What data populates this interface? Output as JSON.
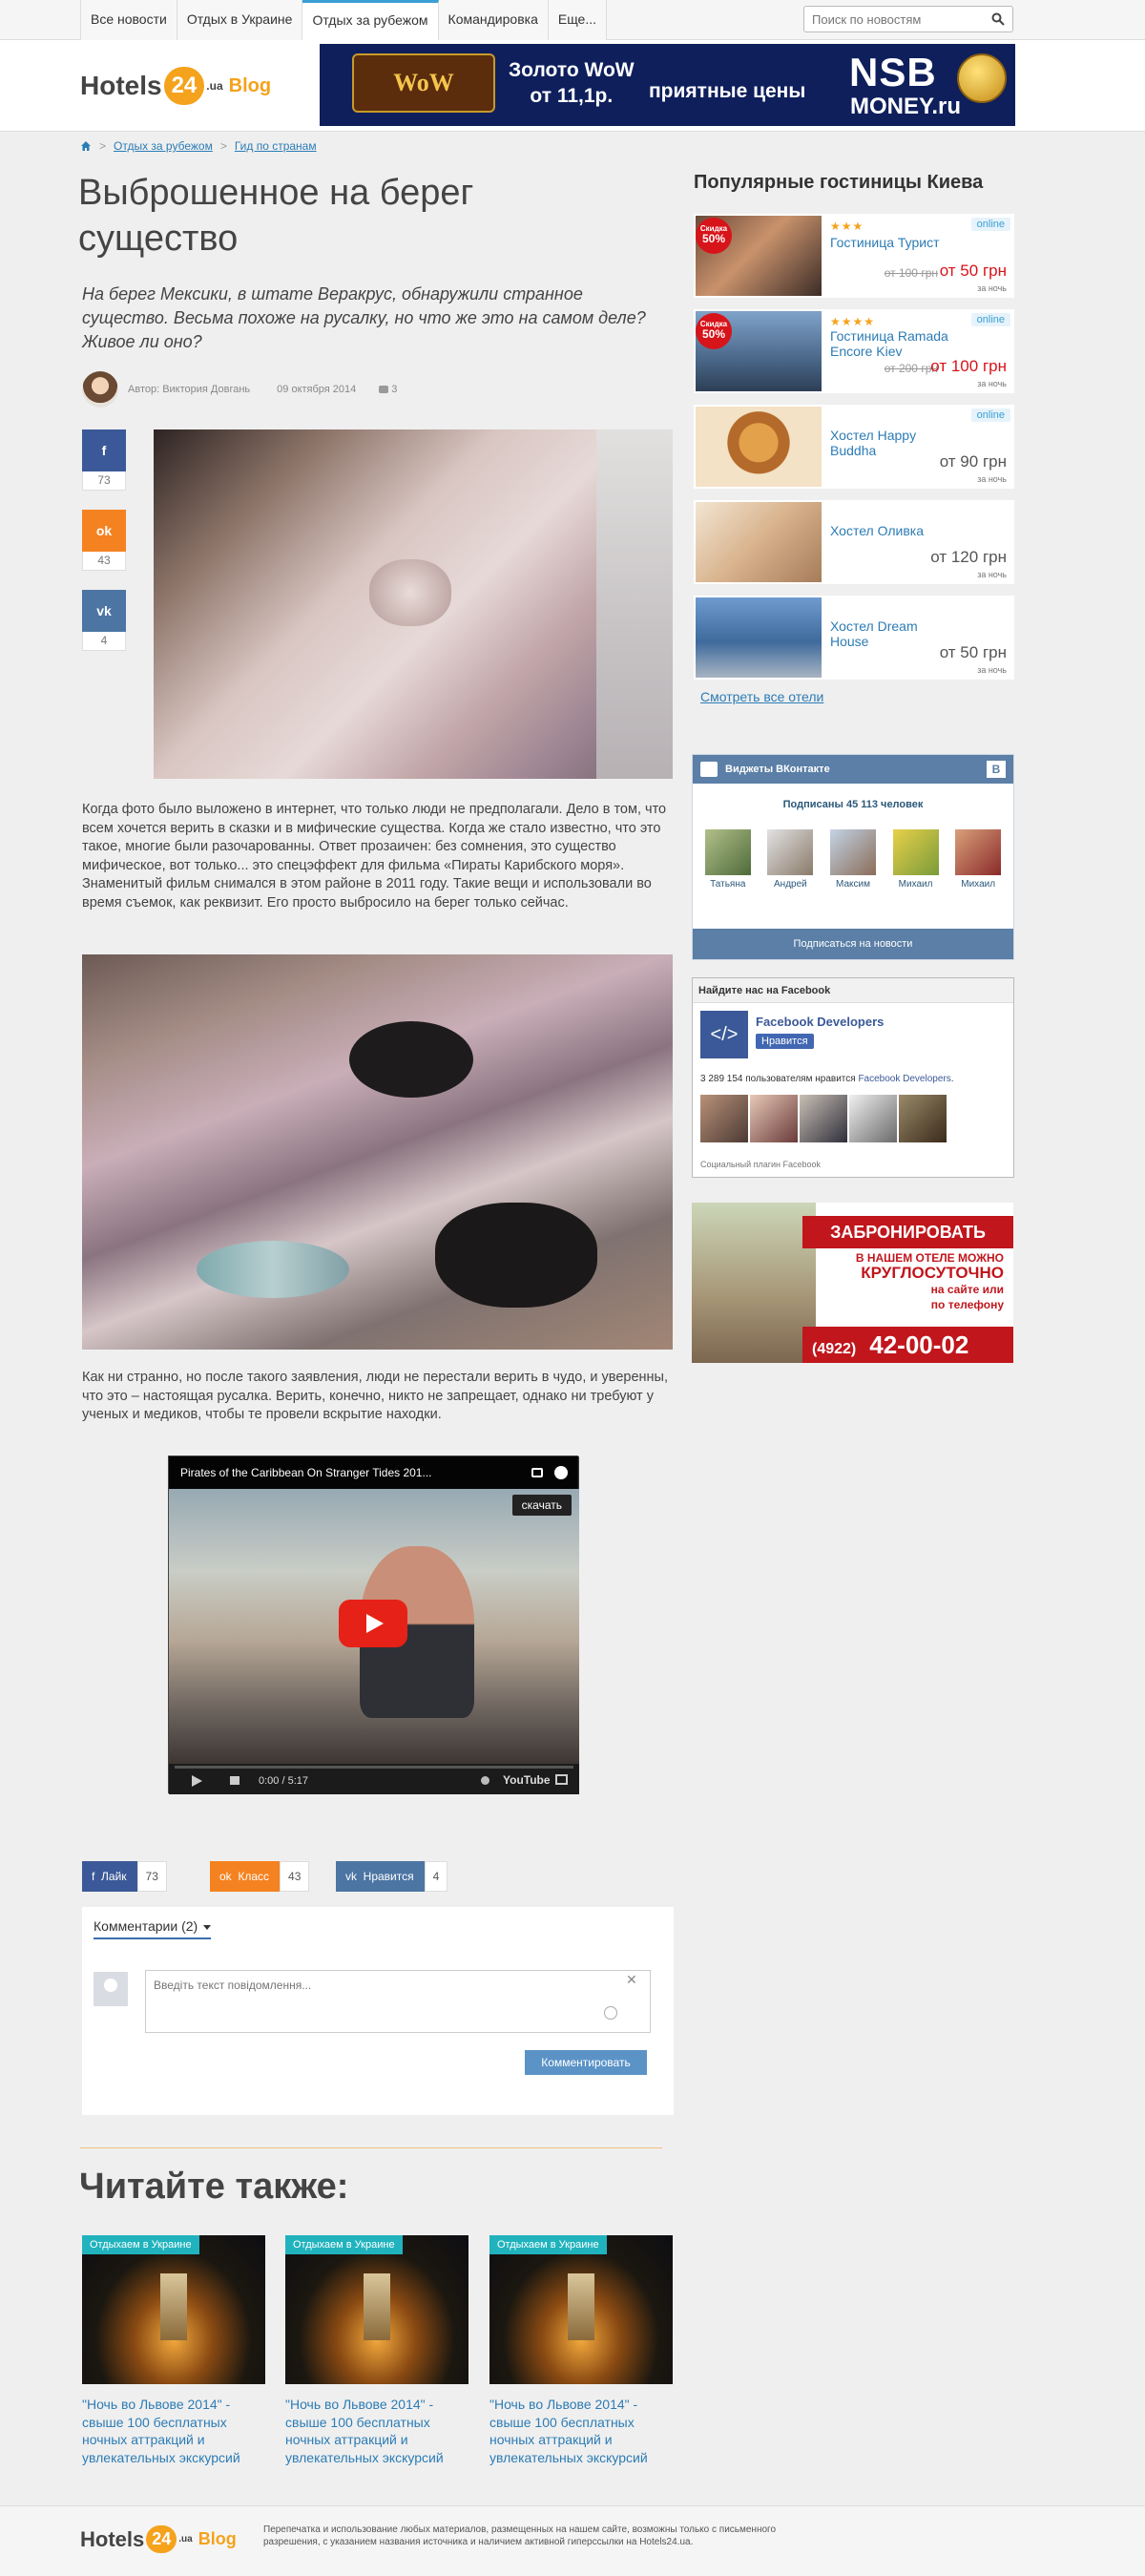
{
  "nav": {
    "items": [
      "Все новости",
      "Отдых в Украине",
      "Отдых за рубежом",
      "Командировка",
      "Еще..."
    ],
    "active_index": 2,
    "search_placeholder": "Поиск по новостям"
  },
  "logo": {
    "part1": "Hotels",
    "part2": "24",
    "part3": ".ua",
    "part4": "Blog"
  },
  "top_banner": {
    "game_logo": "WORLD WARCRAFT",
    "gold_line1": "Золото WoW",
    "gold_line2": "от 11,1р.",
    "prices": "приятные цены",
    "brand1": "NSB",
    "brand2": "MONEY.ru"
  },
  "breadcrumb": {
    "item1": "Отдых за рубежом",
    "item2": "Гид по странам"
  },
  "article": {
    "title": "Выброшенное на берег существо",
    "lead": "На берег Мексики, в штате Веракрус, обнаружили странное существо. Весьма похоже на русалку, но что же это на самом деле? Живое ли оно?",
    "author": "Автор: Виктория Довгань",
    "date": "09 октября 2014",
    "comments_count": "3",
    "para1": "Когда фото было выложено в интернет, что только люди не предполагали. Дело в том, что всем хочется верить в сказки и в мифические существа. Когда же стало известно, что это такое, многие были разочарованны. Ответ прозаичен: без сомнения, это существо мифическое, вот только... это спецэффект для фильма «Пираты Карибского моря». Знаменитый фильм снимался в этом районе в 2011 году. Такие вещи и использовали во время съемок, как реквизит. Его просто выбросило на берег только сейчас.",
    "para2": "Как ни странно, но после такого заявления, люди не перестали верить в чудо, и уверенны, что это – настоящая русалка. Верить, конечно, никто не запрещает, однако ни требуют у ученых и медиков, чтобы те провели вскрытие находки."
  },
  "share_side": {
    "fb": "73",
    "ok": "43",
    "vk": "4",
    "fb_icon": "f",
    "ok_icon": "ok",
    "vk_icon": "vk"
  },
  "video": {
    "title": "Pirates of the Caribbean On Stranger Tides 201...",
    "download": "скачать",
    "time": "0:00 / 5:17",
    "brand": "YouTube"
  },
  "share_bottom": {
    "fb_label": "Лайк",
    "fb_count": "73",
    "ok_label": "Класс",
    "ok_count": "43",
    "vk_label": "Нравится",
    "vk_count": "4"
  },
  "comments": {
    "header": "Комментарии (2)",
    "placeholder": "Введіть текст повідомлення...",
    "close": "✕",
    "submit": "Комментировать"
  },
  "read_also": {
    "title": "Читайте также:",
    "cards": [
      {
        "tag": "Отдыхаем в Украине",
        "title": "\"Ночь во Львове 2014\" - свыше 100 бесплатных ночных аттракций и увлекательных экскурсий"
      },
      {
        "tag": "Отдыхаем в Украине",
        "title": "\"Ночь во Львове 2014\" - свыше 100 бесплатных ночных аттракций и увлекательных экскурсий"
      },
      {
        "tag": "Отдыхаем в Украине",
        "title": "\"Ночь во Львове 2014\" - свыше 100 бесплатных ночных аттракций и увлекательных экскурсий"
      }
    ]
  },
  "sidebar": {
    "heading": "Популярные гостиницы Киева",
    "hotels": [
      {
        "name": "Гостиница Турист",
        "stars": "★★★",
        "online": "online",
        "old": "от 100 грн",
        "price": "от 50 грн",
        "per_night": "за ночь",
        "discount_label": "Скидка",
        "discount": "50%"
      },
      {
        "name": "Гостиница Ramada Encore Kiev",
        "stars": "★★★★",
        "online": "online",
        "old": "от 200 грн",
        "price": "от 100 грн",
        "per_night": "за ночь",
        "discount_label": "Скидка",
        "discount": "50%"
      },
      {
        "name": "Хостел Happy Buddha",
        "online": "online",
        "price": "от 90 грн",
        "per_night": "за ночь"
      },
      {
        "name": "Хостел Оливка",
        "price": "от 120 грн",
        "per_night": "за ночь"
      },
      {
        "name": "Хостел Dream House",
        "price": "от 50 грн",
        "per_night": "за ночь"
      }
    ],
    "all_hotels": "Смотреть все отели",
    "vk": {
      "header": "Виджеты ВКонтакте",
      "subscribers": "Подписаны 45 113 человек",
      "people": [
        "Татьяна",
        "Андрей",
        "Максим",
        "Михаил",
        "Михаил"
      ],
      "button": "Подписаться на новости"
    },
    "fb": {
      "header": "Найдите нас на Facebook",
      "page_name": "Facebook Developers",
      "like": "Нравится",
      "count_prefix": "3 289 154 пользователям нравится",
      "count_link": "Facebook Developers",
      "footer": "Социальный плагин Facebook"
    },
    "ad": {
      "line1": "ЗАБРОНИРОВАТЬ НОМЕР",
      "line2": "В НАШЕМ ОТЕЛЕ МОЖНО",
      "line3": "КРУГЛОСУТОЧНО",
      "line4": "на сайте или",
      "line5": "по телефону",
      "code": "(4922)",
      "phone": "42-00-02"
    }
  },
  "footer": {
    "text": "Перепечатка и использование любых материалов, размещенных на нашем сайте, возможны только с письменного разрешения, с указанием названия источника и наличием активной гиперссылки на Hotels24.ua."
  },
  "colors": {
    "accent": "#3a9fd5",
    "brand": "#f5a21c",
    "facebook": "#3b5998",
    "odnoklassniki": "#f58220",
    "vk": "#4c75a3",
    "price_red": "#d7141a"
  }
}
